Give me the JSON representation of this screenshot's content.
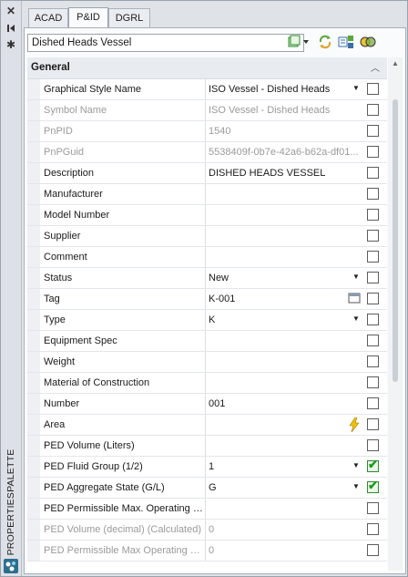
{
  "palette": {
    "title": "PROPERTIESPALETTE",
    "sidebar_icons": [
      "close-icon",
      "autohide-icon",
      "settings-icon"
    ]
  },
  "tabs": [
    "ACAD",
    "P&ID",
    "DGRL"
  ],
  "active_tab": "P&ID",
  "selector": {
    "value": "Dished Heads Vessel"
  },
  "toolbar": [
    "select-objects-icon",
    "refresh-icon",
    "quick-select-icon",
    "toggle-icon"
  ],
  "section": {
    "label": "General"
  },
  "rows": [
    {
      "name": "Graphical Style Name",
      "value": "ISO Vessel - Dished Heads",
      "dropdown": true,
      "dim": false,
      "checked": false
    },
    {
      "name": "Symbol Name",
      "value": "ISO Vessel - Dished Heads",
      "dim": true,
      "checked": false
    },
    {
      "name": "PnPID",
      "value": "1540",
      "dim": true,
      "checked": false
    },
    {
      "name": "PnPGuid",
      "value": "5538409f-0b7e-42a6-b62a-df01...",
      "dim": true,
      "checked": false
    },
    {
      "name": "Description",
      "value": "DISHED HEADS VESSEL",
      "dim": false,
      "checked": false
    },
    {
      "name": "Manufacturer",
      "value": "",
      "dim": false,
      "checked": false
    },
    {
      "name": "Model Number",
      "value": "",
      "dim": false,
      "checked": false
    },
    {
      "name": "Supplier",
      "value": "",
      "dim": false,
      "checked": false
    },
    {
      "name": "Comment",
      "value": "",
      "dim": false,
      "checked": false
    },
    {
      "name": "Status",
      "value": "New",
      "dropdown": true,
      "dim": false,
      "checked": false
    },
    {
      "name": "Tag",
      "value": "K-001",
      "icon": "tag-editor-icon",
      "dim": false,
      "checked": false
    },
    {
      "name": "Type",
      "value": "K",
      "dropdown": true,
      "dim": false,
      "checked": false
    },
    {
      "name": "Equipment Spec",
      "value": "",
      "dim": false,
      "checked": false
    },
    {
      "name": "Weight",
      "value": "",
      "dim": false,
      "checked": false
    },
    {
      "name": "Material of Construction",
      "value": "",
      "dim": false,
      "checked": false
    },
    {
      "name": "Number",
      "value": "001",
      "dim": false,
      "checked": false
    },
    {
      "name": "Area",
      "value": "",
      "icon": "lightning-icon",
      "dim": false,
      "checked": false
    },
    {
      "name": "PED Volume (Liters)",
      "value": "",
      "dim": false,
      "checked": false
    },
    {
      "name": "PED Fluid Group (1/2)",
      "value": "1",
      "dropdown": true,
      "dim": false,
      "checked": true
    },
    {
      "name": "PED Aggregate State (G/L)",
      "value": "G",
      "dropdown": true,
      "dim": false,
      "checked": true
    },
    {
      "name": "PED Permissible Max. Operating Pr...",
      "value": "",
      "dim": false,
      "checked": false
    },
    {
      "name": "PED Volume (decimal) (Calculated)",
      "value": "0",
      "dim": true,
      "checked": false
    },
    {
      "name": "PED Permissible Max Operating Pr...",
      "value": "0",
      "dim": true,
      "checked": false
    }
  ]
}
